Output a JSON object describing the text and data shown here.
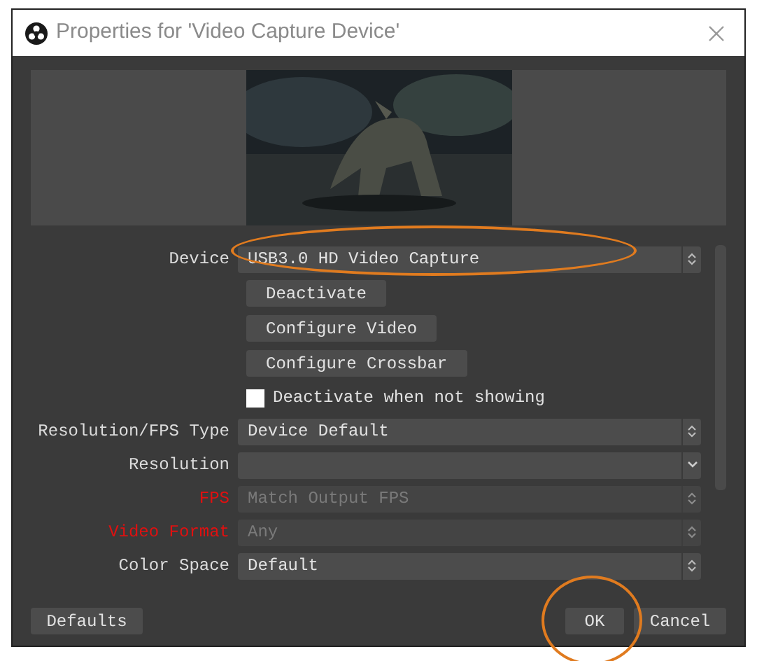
{
  "window": {
    "title": "Properties for 'Video Capture Device'"
  },
  "properties": [
    {
      "kind": "spinner",
      "label": "Device",
      "value": "USB3.0 HD Video Capture",
      "disabled": false,
      "warning": false,
      "highlighted": true
    },
    {
      "kind": "button",
      "text": "Deactivate"
    },
    {
      "kind": "button",
      "text": "Configure Video"
    },
    {
      "kind": "button",
      "text": "Configure Crossbar"
    },
    {
      "kind": "checkbox",
      "text": "Deactivate when not showing",
      "checked": false
    },
    {
      "kind": "spinner",
      "label": "Resolution/FPS Type",
      "value": "Device Default",
      "disabled": false,
      "warning": false,
      "highlighted": false
    },
    {
      "kind": "dropdown",
      "label": "Resolution",
      "disabled": false,
      "warning": false,
      "highlighted": false
    },
    {
      "kind": "spinner",
      "label": "FPS",
      "value": "Match Output FPS",
      "disabled": true,
      "warning": true,
      "highlighted": false
    },
    {
      "kind": "spinner",
      "label": "Video Format",
      "value": "Any",
      "disabled": true,
      "warning": true,
      "highlighted": false
    },
    {
      "kind": "spinner",
      "label": "Color Space",
      "value": "Default",
      "disabled": false,
      "warning": false,
      "highlighted": false
    }
  ],
  "footer": {
    "defaults": "Defaults",
    "ok": {
      "text": "OK",
      "highlighted": true
    },
    "cancel": "Cancel"
  }
}
